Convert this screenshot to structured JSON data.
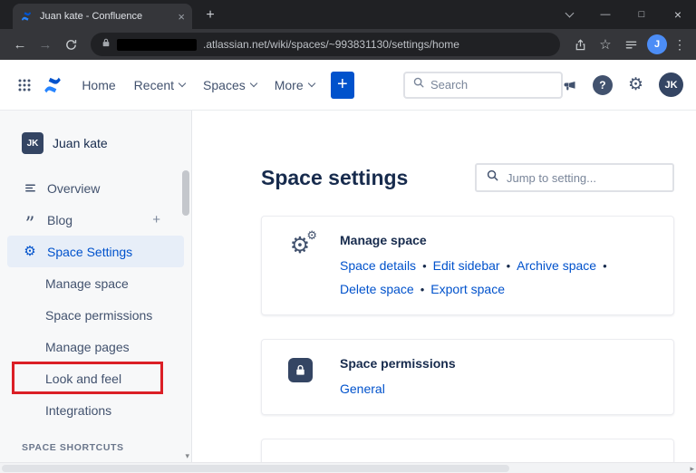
{
  "colors": {
    "link_blue": "#0052CC",
    "brand_blue": "#0052CC",
    "heading": "#172B4D",
    "nav_text": "#42526E",
    "sidebar_bg": "#F7F8F9",
    "active_item_bg": "#E7EEF8",
    "annotation_red": "#DB1F26",
    "chrome_dark": "#202124",
    "chrome_mid": "#35363A"
  },
  "browser": {
    "tab_title": "Juan kate - Confluence",
    "url_visible": ".atlassian.net/wiki/spaces/~993831130/settings/home",
    "profile_initial": "J"
  },
  "glyphs": {
    "bullet": "•",
    "plus": "+",
    "question": "?",
    "gear": "⚙",
    "star": "☆",
    "kebab": "⋮",
    "back": "←",
    "forward": "→",
    "minimize": "—",
    "maximize": "□",
    "close": "×",
    "tab_close": "×",
    "quote": "”",
    "triangle_down": "▾",
    "triangle_right": "▸"
  },
  "header": {
    "nav_items": [
      {
        "label": "Home"
      },
      {
        "label": "Recent"
      },
      {
        "label": "Spaces"
      },
      {
        "label": "More"
      }
    ],
    "create_button": "+",
    "search_placeholder": "Search",
    "help": "?",
    "avatar_initials": "JK"
  },
  "sidebar": {
    "space_avatar": "JK",
    "space_name": "Juan kate",
    "items": [
      {
        "label": "Overview"
      },
      {
        "label": "Blog",
        "add": "+"
      },
      {
        "label": "Space Settings",
        "active": true
      },
      {
        "label": "Manage space"
      },
      {
        "label": "Space permissions"
      },
      {
        "label": "Manage pages"
      },
      {
        "label": "Look and feel",
        "annotated": true
      },
      {
        "label": "Integrations"
      }
    ],
    "section_header": "SPACE SHORTCUTS"
  },
  "main": {
    "title": "Space settings",
    "jump_placeholder": "Jump to setting...",
    "cards": [
      {
        "title": "Manage space",
        "links": [
          "Space details",
          "Edit sidebar",
          "Archive space",
          "Delete space",
          "Export space"
        ]
      },
      {
        "title": "Space permissions",
        "links": [
          "General"
        ]
      }
    ]
  }
}
